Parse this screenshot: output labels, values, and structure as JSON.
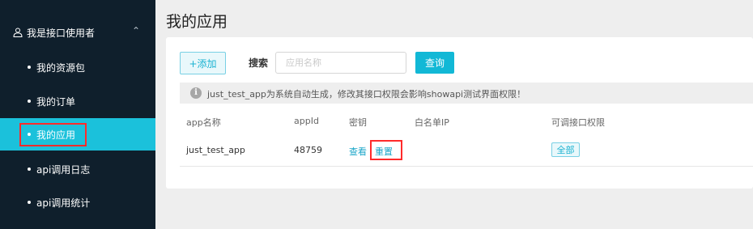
{
  "sidebar": {
    "group_label": "我是接口使用者",
    "items": [
      {
        "label": "我的资源包"
      },
      {
        "label": "我的订单"
      },
      {
        "label": "我的应用"
      },
      {
        "label": "api调用日志"
      },
      {
        "label": "api调用统计"
      }
    ]
  },
  "page": {
    "title": "我的应用"
  },
  "toolbar": {
    "add_label": "+添加",
    "search_label": "搜索",
    "search_placeholder": "应用名称",
    "query_label": "查询"
  },
  "notice": {
    "text": "just_test_app为系统自动生成，修改其接口权限会影响showapi测试界面权限！"
  },
  "table": {
    "headers": [
      "app名称",
      "appId",
      "密钥",
      "白名单IP",
      "可调接口权限"
    ],
    "rows": [
      {
        "app_name": "just_test_app",
        "app_id": "48759",
        "view_label": "查看",
        "reset_label": "重置",
        "whitelist": "",
        "permission": "全部"
      }
    ]
  }
}
